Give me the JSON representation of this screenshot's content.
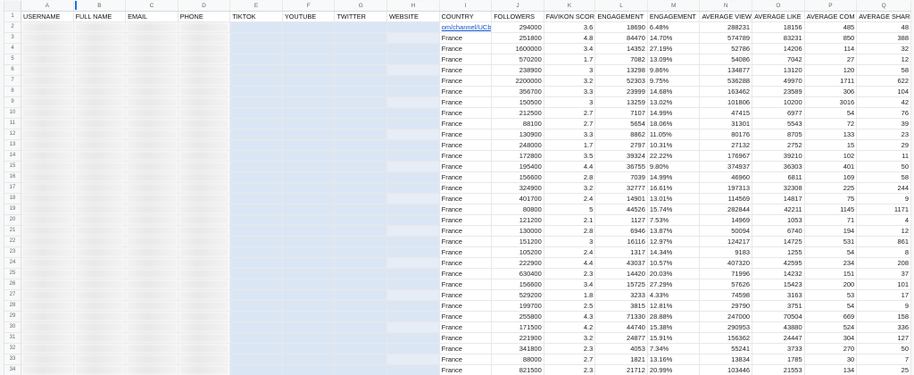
{
  "columns": [
    "A",
    "B",
    "C",
    "D",
    "E",
    "F",
    "G",
    "H",
    "I",
    "J",
    "K",
    "L",
    "M",
    "N",
    "O",
    "P",
    "Q"
  ],
  "headers": [
    "USERNAME",
    "FULL NAME",
    "EMAIL",
    "PHONE",
    "TIKTOK",
    "YOUTUBE",
    "TWITTER",
    "WEBSITE",
    "COUNTRY",
    "FOLLOWERS",
    "FAVIKON SCOR",
    "ENGAGEMENT",
    "ENGAGEMENT",
    "AVERAGE VIEW",
    "AVERAGE LIKE",
    "AVERAGE COM",
    "AVERAGE SHARES"
  ],
  "first_country_value": "om/channel/UCb",
  "rows": [
    [
      "2",
      "294000",
      "3.6",
      "18690",
      "6.48%",
      "288231",
      "18156",
      "485",
      "48"
    ],
    [
      "3",
      "251800",
      "4.8",
      "84470",
      "14.70%",
      "574789",
      "83231",
      "850",
      "388"
    ],
    [
      "4",
      "1600000",
      "3.4",
      "14352",
      "27.19%",
      "52786",
      "14206",
      "114",
      "32"
    ],
    [
      "5",
      "570200",
      "1.7",
      "7082",
      "13.09%",
      "54086",
      "7042",
      "27",
      "12"
    ],
    [
      "6",
      "238900",
      "3",
      "13298",
      "9.86%",
      "134877",
      "13120",
      "120",
      "58"
    ],
    [
      "7",
      "2200000",
      "3.2",
      "52303",
      "9.75%",
      "536288",
      "49970",
      "1711",
      "622"
    ],
    [
      "8",
      "356700",
      "3.3",
      "23999",
      "14.68%",
      "163462",
      "23589",
      "306",
      "104"
    ],
    [
      "9",
      "150500",
      "3",
      "13259",
      "13.02%",
      "101806",
      "10200",
      "3016",
      "42"
    ],
    [
      "10",
      "212500",
      "2.7",
      "7107",
      "14.99%",
      "47415",
      "6977",
      "54",
      "76"
    ],
    [
      "11",
      "88100",
      "2.7",
      "5654",
      "18.06%",
      "31301",
      "5543",
      "72",
      "39"
    ],
    [
      "12",
      "130900",
      "3.3",
      "8862",
      "11.05%",
      "80176",
      "8705",
      "133",
      "23"
    ],
    [
      "13",
      "248000",
      "1.7",
      "2797",
      "10.31%",
      "27132",
      "2752",
      "15",
      "29"
    ],
    [
      "14",
      "172800",
      "3.5",
      "39324",
      "22.22%",
      "176967",
      "39210",
      "102",
      "11"
    ],
    [
      "15",
      "195400",
      "4.4",
      "36755",
      "9.80%",
      "374937",
      "36303",
      "401",
      "50"
    ],
    [
      "16",
      "156600",
      "2.8",
      "7039",
      "14.99%",
      "46960",
      "6811",
      "169",
      "58"
    ],
    [
      "17",
      "324900",
      "3.2",
      "32777",
      "16.61%",
      "197313",
      "32308",
      "225",
      "244"
    ],
    [
      "18",
      "401700",
      "2.4",
      "14901",
      "13.01%",
      "114569",
      "14817",
      "75",
      "9"
    ],
    [
      "19",
      "80800",
      "5",
      "44526",
      "15.74%",
      "282844",
      "42211",
      "1145",
      "1171"
    ],
    [
      "20",
      "121200",
      "2.1",
      "1127",
      "7.53%",
      "14969",
      "1053",
      "71",
      "4"
    ],
    [
      "21",
      "130000",
      "2.8",
      "6946",
      "13.87%",
      "50094",
      "6740",
      "194",
      "12"
    ],
    [
      "22",
      "151200",
      "3",
      "16116",
      "12.97%",
      "124217",
      "14725",
      "531",
      "861"
    ],
    [
      "23",
      "105200",
      "2.4",
      "1317",
      "14.34%",
      "9183",
      "1255",
      "54",
      "8"
    ],
    [
      "24",
      "222900",
      "4.4",
      "43037",
      "10.57%",
      "407320",
      "42595",
      "234",
      "208"
    ],
    [
      "25",
      "630400",
      "2.3",
      "14420",
      "20.03%",
      "71996",
      "14232",
      "151",
      "37"
    ],
    [
      "26",
      "156600",
      "3.4",
      "15725",
      "27.29%",
      "57626",
      "15423",
      "200",
      "101"
    ],
    [
      "27",
      "529200",
      "1.8",
      "3233",
      "4.33%",
      "74598",
      "3163",
      "53",
      "17"
    ],
    [
      "28",
      "199700",
      "2.5",
      "3815",
      "12.81%",
      "29790",
      "3751",
      "54",
      "9"
    ],
    [
      "29",
      "255800",
      "4.3",
      "71330",
      "28.88%",
      "247000",
      "70504",
      "669",
      "158"
    ],
    [
      "30",
      "171500",
      "4.2",
      "44740",
      "15.38%",
      "290953",
      "43880",
      "524",
      "336"
    ],
    [
      "31",
      "221900",
      "3.2",
      "24877",
      "15.91%",
      "156362",
      "24447",
      "304",
      "127"
    ],
    [
      "32",
      "341800",
      "2.3",
      "4053",
      "7.34%",
      "55241",
      "3733",
      "270",
      "50"
    ],
    [
      "33",
      "88000",
      "2.7",
      "1821",
      "13.16%",
      "13834",
      "1785",
      "30",
      "7"
    ],
    [
      "34",
      "821500",
      "2.3",
      "21712",
      "20.99%",
      "103446",
      "21553",
      "134",
      "25"
    ]
  ],
  "country": "France"
}
